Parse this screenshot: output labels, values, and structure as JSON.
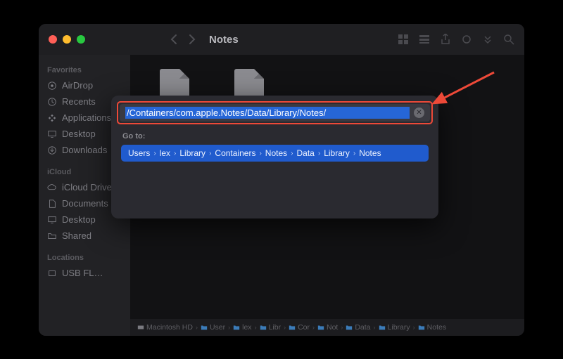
{
  "window": {
    "title": "Notes"
  },
  "sidebar": {
    "favorites_heading": "Favorites",
    "icloud_heading": "iCloud",
    "locations_heading": "Locations",
    "items": [
      {
        "label": "AirDrop"
      },
      {
        "label": "Recents"
      },
      {
        "label": "Applications"
      },
      {
        "label": "Desktop"
      },
      {
        "label": "Downloads"
      }
    ],
    "icloud_items": [
      {
        "label": "iCloud Drive"
      },
      {
        "label": "Documents"
      },
      {
        "label": "Desktop"
      },
      {
        "label": "Shared"
      }
    ],
    "location_items": [
      {
        "label": "USB FL…"
      }
    ]
  },
  "goto": {
    "input_value": "/Containers/com.apple.Notes/Data/Library/Notes/",
    "label": "Go to:",
    "result_segments": [
      "Users",
      "lex",
      "Library",
      "Containers",
      "Notes",
      "Data",
      "Library",
      "Notes"
    ]
  },
  "pathbar": {
    "segments": [
      "Macintosh HD",
      "User",
      "lex",
      "Libr",
      "Cor",
      "Not",
      "Data",
      "Library",
      "Notes"
    ]
  }
}
